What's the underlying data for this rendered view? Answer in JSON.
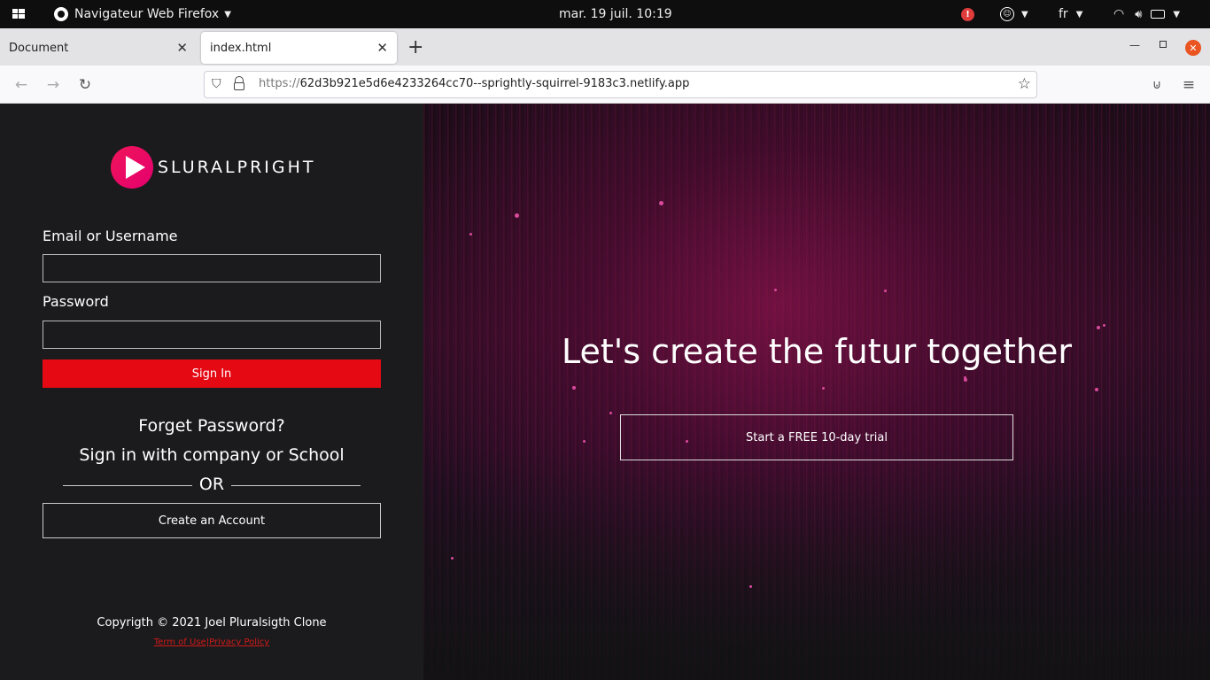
{
  "system_bar": {
    "app_name": "Navigateur Web Firefox",
    "datetime": "mar. 19 juil. 10:19",
    "language": "fr"
  },
  "browser": {
    "tabs": [
      {
        "label": "Document"
      },
      {
        "label": "index.html"
      }
    ],
    "url_protocol": "https://",
    "url_rest": "62d3b921e5d6e4233264cc70--sprightly-squirrel-9183c3.netlify.app"
  },
  "login": {
    "logo_text": "SLURALPRIGHT",
    "email_label": "Email or Username",
    "password_label": "Password",
    "signin_label": "Sign In",
    "forget_password": "Forget Password?",
    "company_signin": "Sign in with company or School",
    "or_text": "OR",
    "create_account": "Create an Account",
    "copyright": "Copyrigth © 2021 Joel Pluralsigth Clone",
    "terms": "Term of Use",
    "separator": "|",
    "privacy": "Privacy Policy"
  },
  "hero": {
    "headline": "Let's create the futur together",
    "trial_button": "Start a FREE 10-day trial"
  },
  "colors": {
    "accent_red": "#e50913",
    "logo_pink": "#f0155a",
    "link_red": "#d11a1a"
  }
}
